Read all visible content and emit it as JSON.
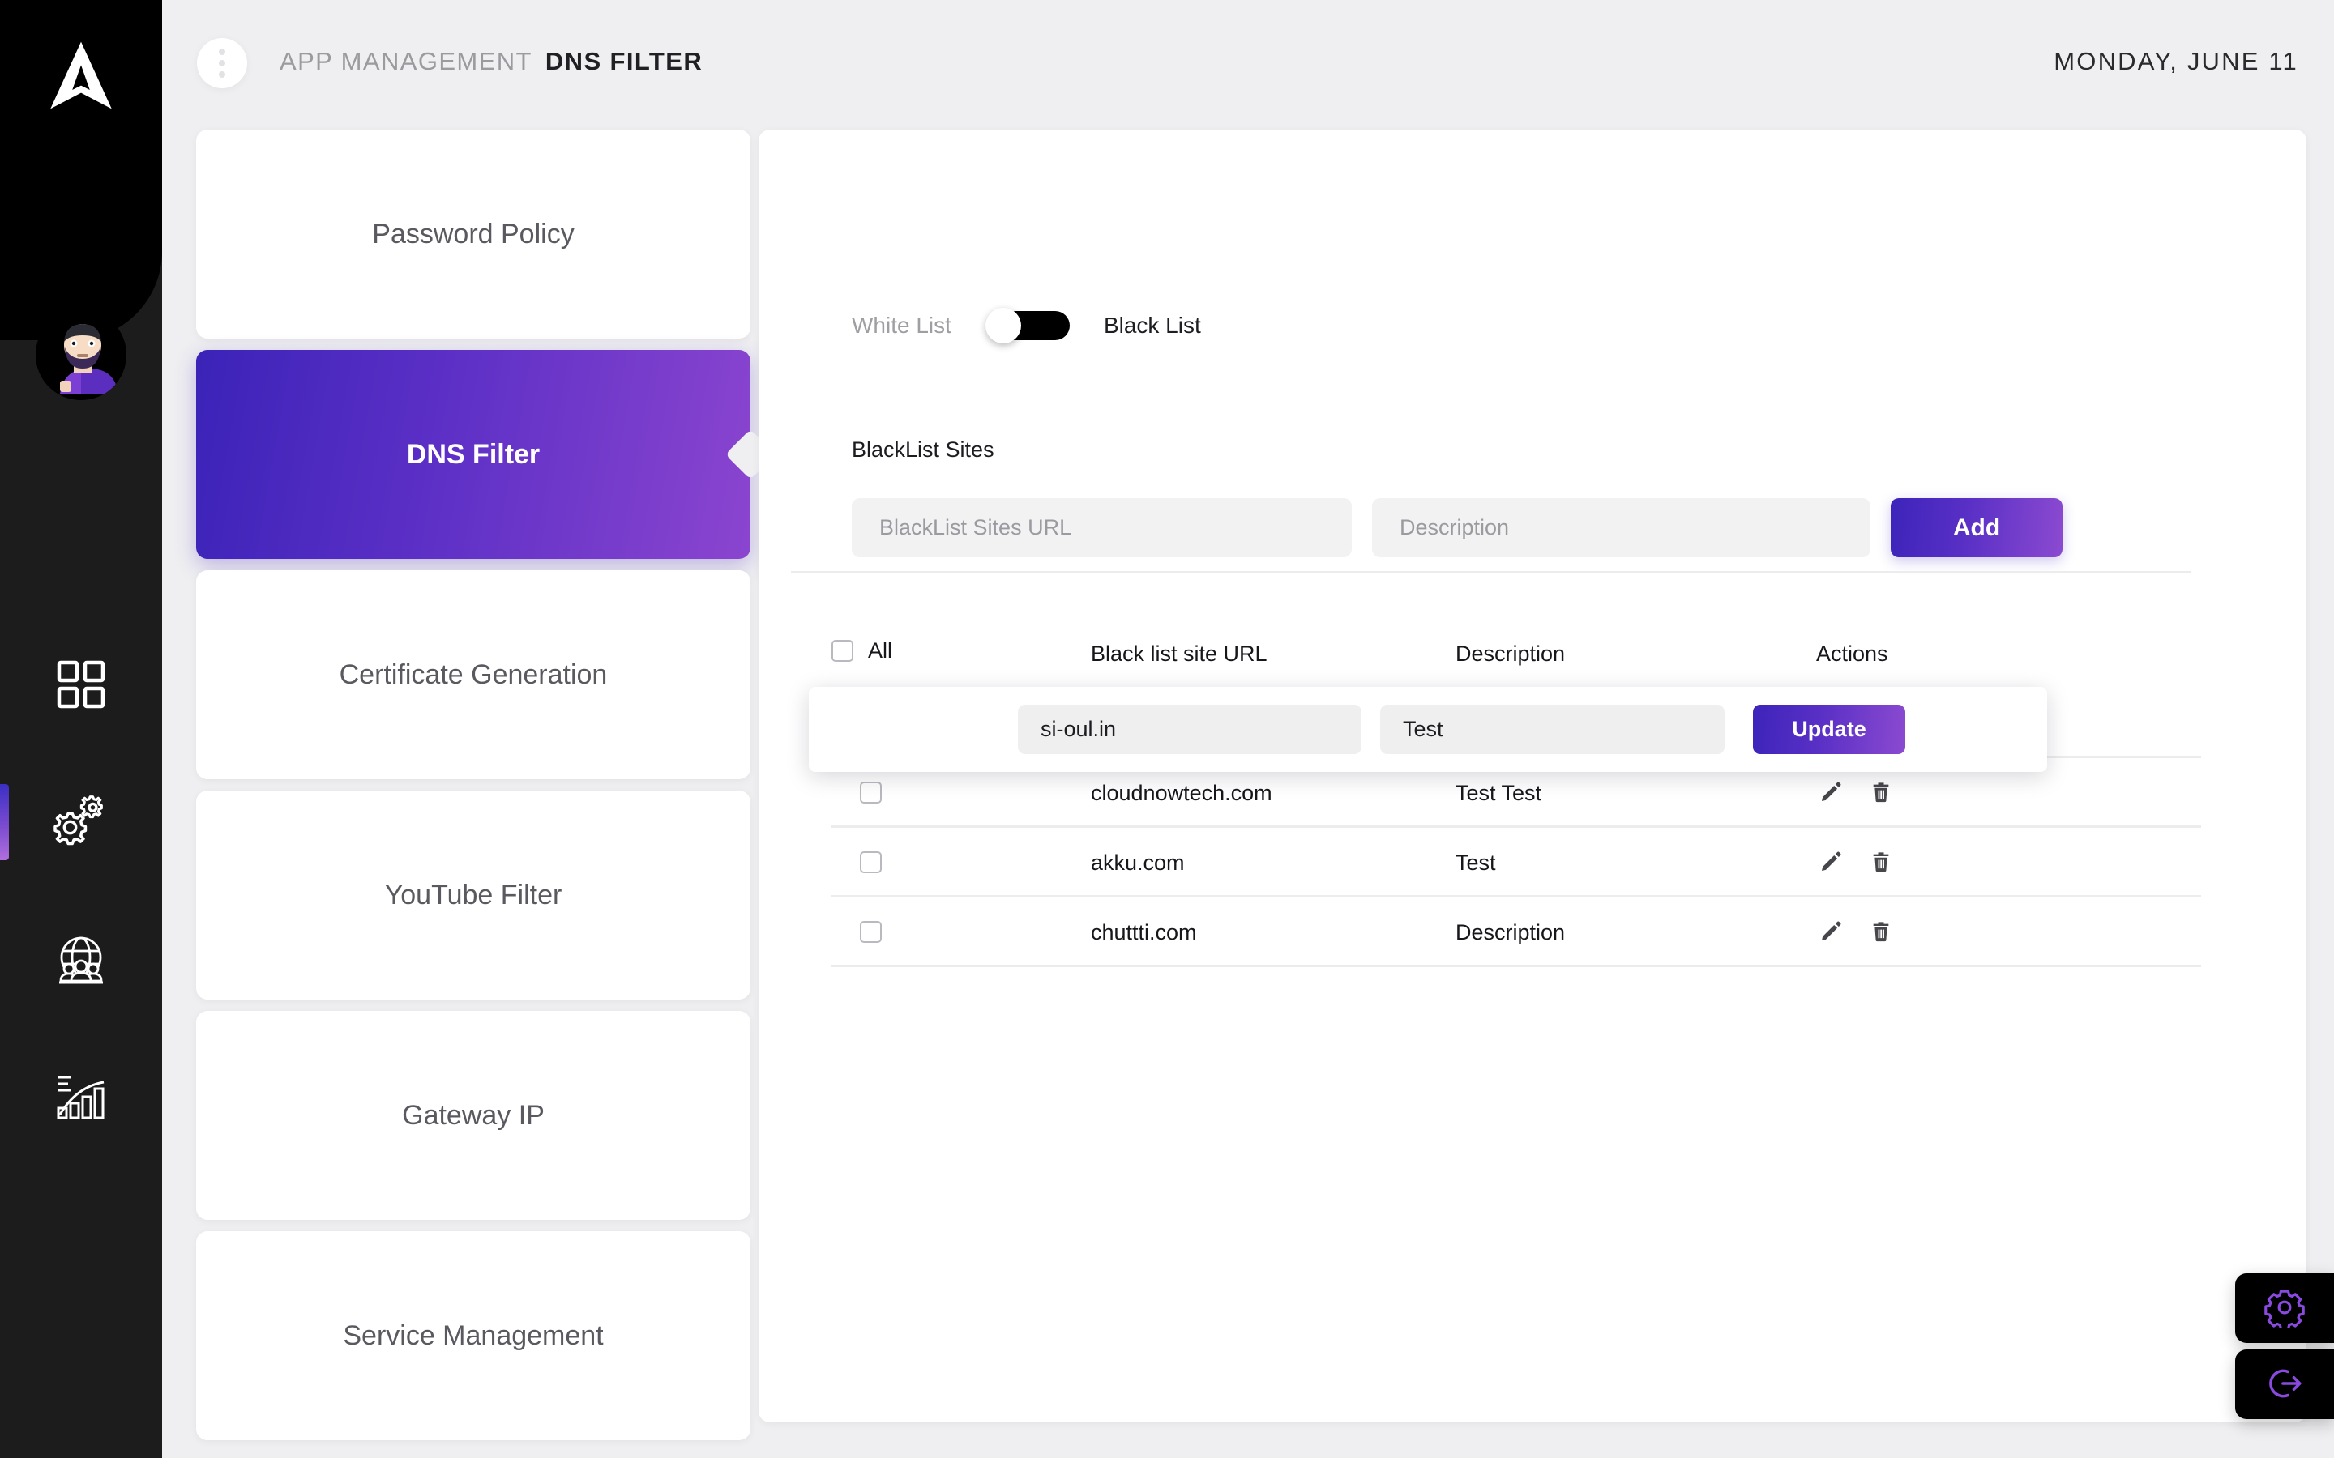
{
  "brand": {
    "logo_icon": "arrow-logo",
    "avatar_icon": "user-avatar"
  },
  "header": {
    "kebab_icon": "kebab-menu-icon",
    "breadcrumb_parent": "APP MANAGEMENT",
    "breadcrumb_current": "DNS FILTER",
    "date": "MONDAY, JUNE 11"
  },
  "rail": {
    "items": [
      {
        "icon": "grid-dashboard-icon",
        "active": false
      },
      {
        "icon": "gears-settings-icon",
        "active": true
      },
      {
        "icon": "globe-users-icon",
        "active": false
      },
      {
        "icon": "bar-chart-icon",
        "active": false
      }
    ]
  },
  "menu": {
    "items": [
      {
        "label": "Password Policy",
        "active": false
      },
      {
        "label": "DNS Filter",
        "active": true
      },
      {
        "label": "Certificate Generation",
        "active": false
      },
      {
        "label": "YouTube Filter",
        "active": false
      },
      {
        "label": "Gateway IP",
        "active": false
      },
      {
        "label": "Service Management",
        "active": false
      }
    ]
  },
  "toggle": {
    "left_label": "White List",
    "right_label": "Black List",
    "selected": "Black List"
  },
  "form": {
    "section_label": "BlackList Sites",
    "url_placeholder": "BlackList Sites URL",
    "url_value": "",
    "desc_placeholder": "Description",
    "desc_value": "",
    "add_label": "Add"
  },
  "table": {
    "headers": {
      "all": "All",
      "url": "Black list site URL",
      "description": "Description",
      "actions": "Actions"
    },
    "rows": [
      {
        "url": "cloudnowtech.com",
        "description": "Test",
        "checked": false
      },
      {
        "url": "cloudnowtech.com",
        "description": "Test Test",
        "checked": false
      },
      {
        "url": "akku.com",
        "description": "Test",
        "checked": false
      },
      {
        "url": "chuttti.com",
        "description": "Description",
        "checked": false
      }
    ],
    "row_actions": {
      "edit_icon": "pencil-edit-icon",
      "delete_icon": "trash-delete-icon"
    }
  },
  "edit_row": {
    "url_value": "si-oul.in",
    "desc_value": "Test",
    "update_label": "Update"
  },
  "fabs": [
    {
      "icon": "gear-settings-icon"
    },
    {
      "icon": "logout-icon"
    }
  ],
  "colors": {
    "accent_start": "#3d24ba",
    "accent_end": "#8b4ad0",
    "rail_bg": "#1c1c1c",
    "page_bg": "#efeff1"
  }
}
